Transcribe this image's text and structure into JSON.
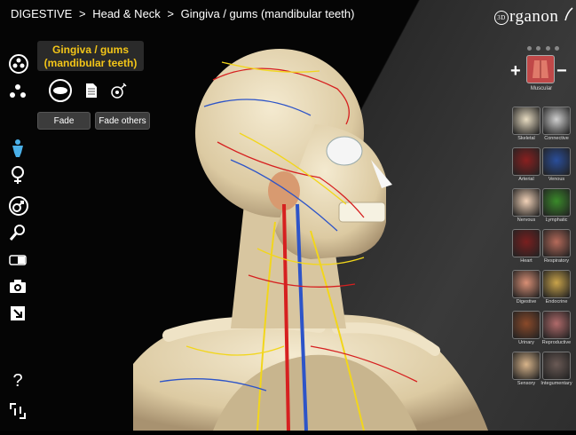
{
  "breadcrumb": {
    "items": [
      "DIGESTIVE",
      "Head & Neck",
      "Gingiva / gums (mandibular teeth)"
    ],
    "separator": ">"
  },
  "logo": {
    "ring_text": "3D",
    "name": "rganon"
  },
  "info_panel": {
    "title_line1": "Gingiva / gums",
    "title_line2": "(mandibular teeth)",
    "fade_label": "Fade",
    "fade_others_label": "Fade others"
  },
  "left_tools": [
    {
      "icon": "layers-icon"
    },
    {
      "icon": "molecule-icon"
    },
    {
      "icon": "body-icon"
    },
    {
      "icon": "female-icon"
    },
    {
      "icon": "male-icon"
    },
    {
      "icon": "search-icon"
    },
    {
      "icon": "toggle-icon"
    },
    {
      "icon": "camera-icon"
    },
    {
      "icon": "share-icon"
    },
    {
      "icon": "help-icon",
      "text": "?"
    },
    {
      "icon": "fullscreen-icon"
    }
  ],
  "right_panel": {
    "plus": "+",
    "minus": "−",
    "current_system": "Muscular",
    "systems": [
      {
        "label": "Skeletal",
        "color": "#e8dcc2"
      },
      {
        "label": "Connective",
        "color": "#cfcfcf"
      },
      {
        "label": "Arterial",
        "color": "#8a2020"
      },
      {
        "label": "Venous",
        "color": "#2a4e9a"
      },
      {
        "label": "Nervous",
        "color": "#f2d2b8"
      },
      {
        "label": "Lymphatic",
        "color": "#3a8a2a"
      },
      {
        "label": "Heart",
        "color": "#7a1f1f"
      },
      {
        "label": "Respiratory",
        "color": "#b56a5a"
      },
      {
        "label": "Digestive",
        "color": "#d98f75"
      },
      {
        "label": "Endocrine",
        "color": "#c9a34a"
      },
      {
        "label": "Urinary",
        "color": "#8b4a2a"
      },
      {
        "label": "Reproductive",
        "color": "#b06a6a"
      },
      {
        "label": "Sensory",
        "color": "#d8b48a"
      },
      {
        "label": "Integumentary",
        "color": "#6a5a55"
      }
    ]
  },
  "colors": {
    "accent_yellow": "#f3c518",
    "bone": "#e6d9b8",
    "artery": "#d62020",
    "vein": "#2d54c8",
    "nerve": "#f2d61b"
  }
}
